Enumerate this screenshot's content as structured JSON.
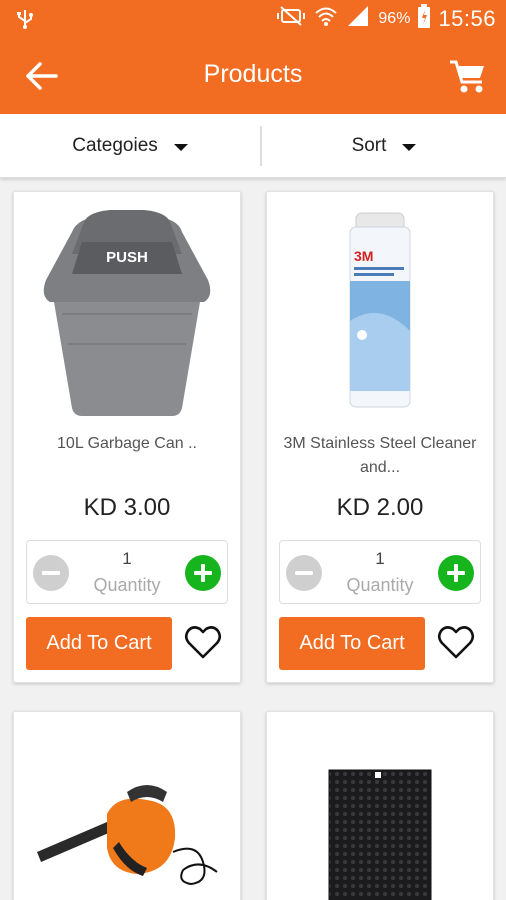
{
  "status_bar": {
    "battery_percent": "96%",
    "time": "15:56"
  },
  "header": {
    "title": "Products"
  },
  "filters": {
    "categories_label": "Categoies",
    "sort_label": "Sort"
  },
  "products": [
    {
      "name": "10L Garbage Can ..",
      "price": "KD 3.00",
      "quantity": "1",
      "quantity_label": "Quantity",
      "add_to_cart": "Add To Cart",
      "image_text": "PUSH"
    },
    {
      "name": "3M Stainless Steel Cleaner and...",
      "price": "KD 2.00",
      "quantity": "1",
      "quantity_label": "Quantity",
      "add_to_cart": "Add To Cart",
      "image_text": "3M"
    }
  ],
  "colors": {
    "brand": "#f26c22",
    "plus": "#16b51e",
    "minus": "#cfcfcf"
  },
  "icons": [
    "usb-icon",
    "mute-icon",
    "wifi-icon",
    "signal-icon",
    "battery-icon",
    "back-arrow-icon",
    "cart-icon",
    "caret-down-icon",
    "minus-icon",
    "plus-icon",
    "heart-icon"
  ]
}
